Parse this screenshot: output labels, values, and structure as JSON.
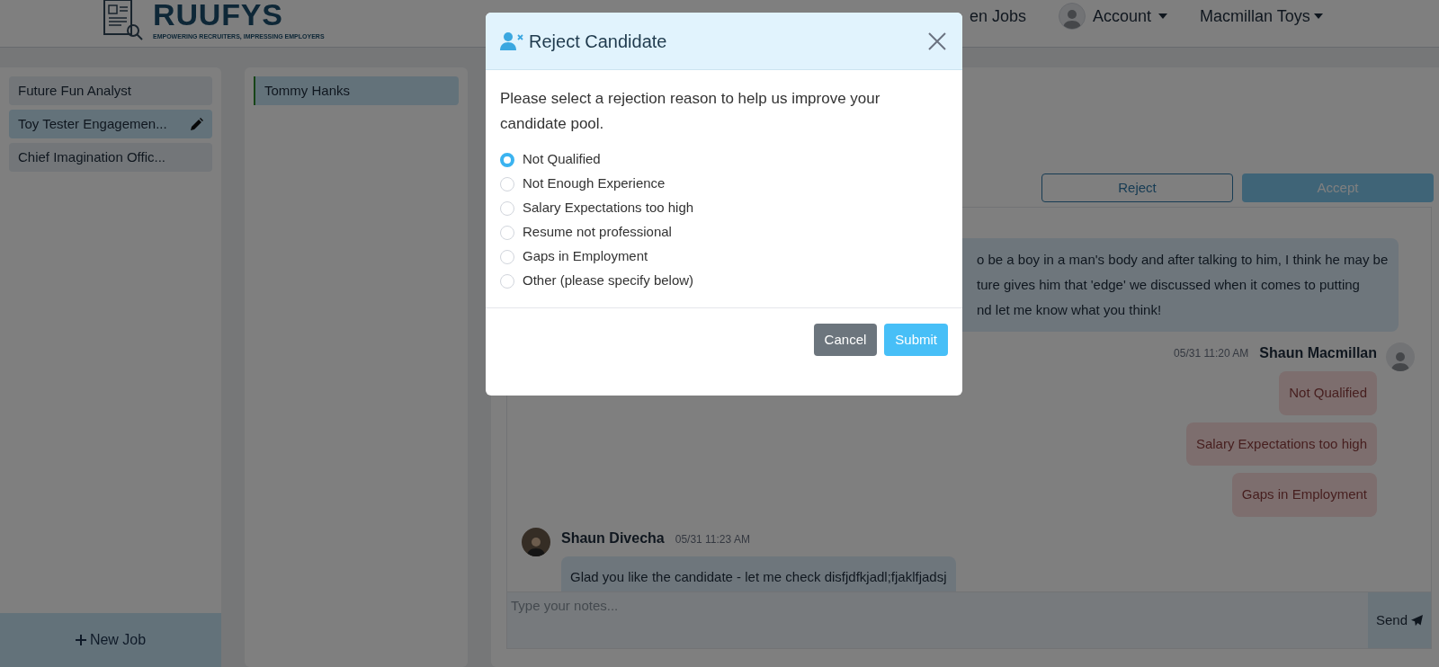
{
  "header": {
    "logo": {
      "name": "RUUFYS",
      "tagline": "EMPOWERING RECRUITERS, IMPRESSING EMPLOYERS"
    },
    "nav": [
      {
        "kind": "link",
        "label": "en Jobs"
      },
      {
        "kind": "account",
        "label": "Account"
      },
      {
        "kind": "dropdown",
        "label": "Macmillan Toys"
      }
    ]
  },
  "jobs": {
    "items": [
      {
        "title": "Future Fun Analyst",
        "selected": false
      },
      {
        "title": "Toy Tester Engagemen...",
        "selected": true
      },
      {
        "title": "Chief Imagination Offic...",
        "selected": false
      }
    ],
    "new_button": "New Job"
  },
  "candidates": [
    {
      "name": "Tommy Hanks",
      "selected": true
    }
  ],
  "actions": {
    "reject": "Reject",
    "accept": "Accept"
  },
  "messages": [
    {
      "kind": "partial",
      "lines": [
        "o be a boy in a man's body and after talking to him, I think he may be",
        "ture gives him that 'edge' we discussed when it comes to putting",
        "nd let me know what you think!"
      ]
    },
    {
      "kind": "outgoing",
      "time": "05/31 11:20 AM",
      "author": "Shaun Macmillan",
      "reasons": [
        "Not Qualified",
        "Salary Expectations too high",
        "Gaps in Employment"
      ]
    },
    {
      "kind": "incoming",
      "author": "Shaun Divecha",
      "time": "05/31 11:23 AM",
      "text": "Glad you like the candidate - let me check disfjdfkjadl;fjaklfjadsj"
    }
  ],
  "notes": {
    "placeholder": "Type your notes...",
    "send": "Send"
  },
  "modal": {
    "title": "Reject Candidate",
    "prompt": "Please select a rejection reason to help us improve your candidate pool.",
    "options": [
      {
        "label": "Not Qualified",
        "selected": true
      },
      {
        "label": "Not Enough Experience",
        "selected": false
      },
      {
        "label": "Salary Expectations too high",
        "selected": false
      },
      {
        "label": "Resume not professional",
        "selected": false
      },
      {
        "label": "Gaps in Employment",
        "selected": false
      },
      {
        "label": "Other (please specify below)",
        "selected": false
      }
    ],
    "cancel": "Cancel",
    "submit": "Submit"
  }
}
